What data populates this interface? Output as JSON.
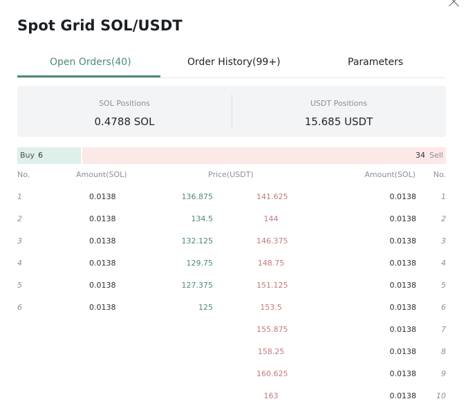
{
  "title": "Spot Grid SOL/USDT",
  "tabs": [
    {
      "label": "Open Orders(40)",
      "active": true
    },
    {
      "label": "Order History(99+)",
      "active": false
    },
    {
      "label": "Parameters",
      "active": false
    }
  ],
  "positions": {
    "sol_label": "SOL Positions",
    "sol_value": "0.4788 SOL",
    "usdt_label": "USDT Positions",
    "usdt_value": "15.685 USDT"
  },
  "ratio": {
    "buy_label": "Buy",
    "buy_count": "6",
    "sell_label": "Sell",
    "sell_count": "34"
  },
  "headers": {
    "no_left": "No.",
    "amount_left": "Amount(SOL)",
    "price": "Price(USDT)",
    "amount_right": "Amount(SOL)",
    "no_right": "No."
  },
  "buy_orders": [
    {
      "no": "1",
      "amount": "0.0138",
      "price": "136.875"
    },
    {
      "no": "2",
      "amount": "0.0138",
      "price": "134.5"
    },
    {
      "no": "3",
      "amount": "0.0138",
      "price": "132.125"
    },
    {
      "no": "4",
      "amount": "0.0138",
      "price": "129.75"
    },
    {
      "no": "5",
      "amount": "0.0138",
      "price": "127.375"
    },
    {
      "no": "6",
      "amount": "0.0138",
      "price": "125"
    }
  ],
  "sell_orders": [
    {
      "no": "1",
      "amount": "0.0138",
      "price": "141.625"
    },
    {
      "no": "2",
      "amount": "0.0138",
      "price": "144"
    },
    {
      "no": "3",
      "amount": "0.0138",
      "price": "146.375"
    },
    {
      "no": "4",
      "amount": "0.0138",
      "price": "148.75"
    },
    {
      "no": "5",
      "amount": "0.0138",
      "price": "151.125"
    },
    {
      "no": "6",
      "amount": "0.0138",
      "price": "153.5"
    },
    {
      "no": "7",
      "amount": "0.0138",
      "price": "155.875"
    },
    {
      "no": "8",
      "amount": "0.0138",
      "price": "158.25"
    },
    {
      "no": "9",
      "amount": "0.0138",
      "price": "160.625"
    },
    {
      "no": "10",
      "amount": "0.0138",
      "price": "163"
    }
  ],
  "colors": {
    "accent_green": "#4e8a72",
    "sell_red": "#c07a7a",
    "buy_bg": "#dff0ea",
    "sell_bg": "#fde8e8"
  }
}
